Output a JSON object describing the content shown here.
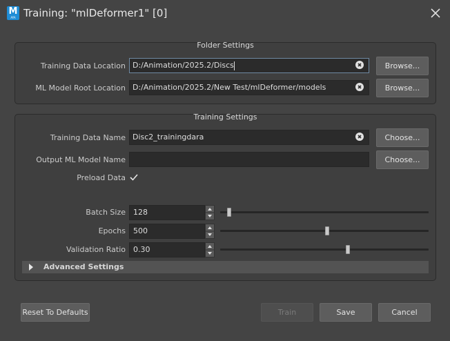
{
  "window": {
    "title": "Training: \"mlDeformer1\" [0]",
    "app_icon_letter": "M",
    "app_icon_sub": "AYA"
  },
  "folder_settings": {
    "title": "Folder Settings",
    "training_data_location": {
      "label": "Training Data Location",
      "value": "D:/Animation/2025.2/Discs",
      "button": "Browse..."
    },
    "ml_model_root_location": {
      "label": "ML Model Root Location",
      "value": "D:/Animation/2025.2/New Test/mlDeformer/models",
      "button": "Browse..."
    }
  },
  "training_settings": {
    "title": "Training Settings",
    "training_data_name": {
      "label": "Training Data Name",
      "value": "Disc2_trainingdara",
      "button": "Choose..."
    },
    "output_ml_model_name": {
      "label": "Output ML Model Name",
      "value": "",
      "button": "Choose..."
    },
    "preload_data": {
      "label": "Preload Data",
      "checked": true
    },
    "batch_size": {
      "label": "Batch Size",
      "value": "128",
      "slider_fraction": 0.02
    },
    "epochs": {
      "label": "Epochs",
      "value": "500",
      "slider_fraction": 0.5
    },
    "validation_ratio": {
      "label": "Validation Ratio",
      "value": "0.30",
      "slider_fraction": 0.6
    },
    "advanced_settings": {
      "label": "Advanced Settings",
      "expanded": false
    }
  },
  "footer": {
    "reset_label": "Reset To Defaults",
    "train_label": "Train",
    "save_label": "Save",
    "cancel_label": "Cancel"
  },
  "colors": {
    "background": "#444444",
    "group_background": "#3f3f3f",
    "field_background": "#2b2b2b",
    "button_background": "#5d5d5d",
    "focus_border": "#6f8aa3",
    "app_icon": "#1f8dd6"
  }
}
